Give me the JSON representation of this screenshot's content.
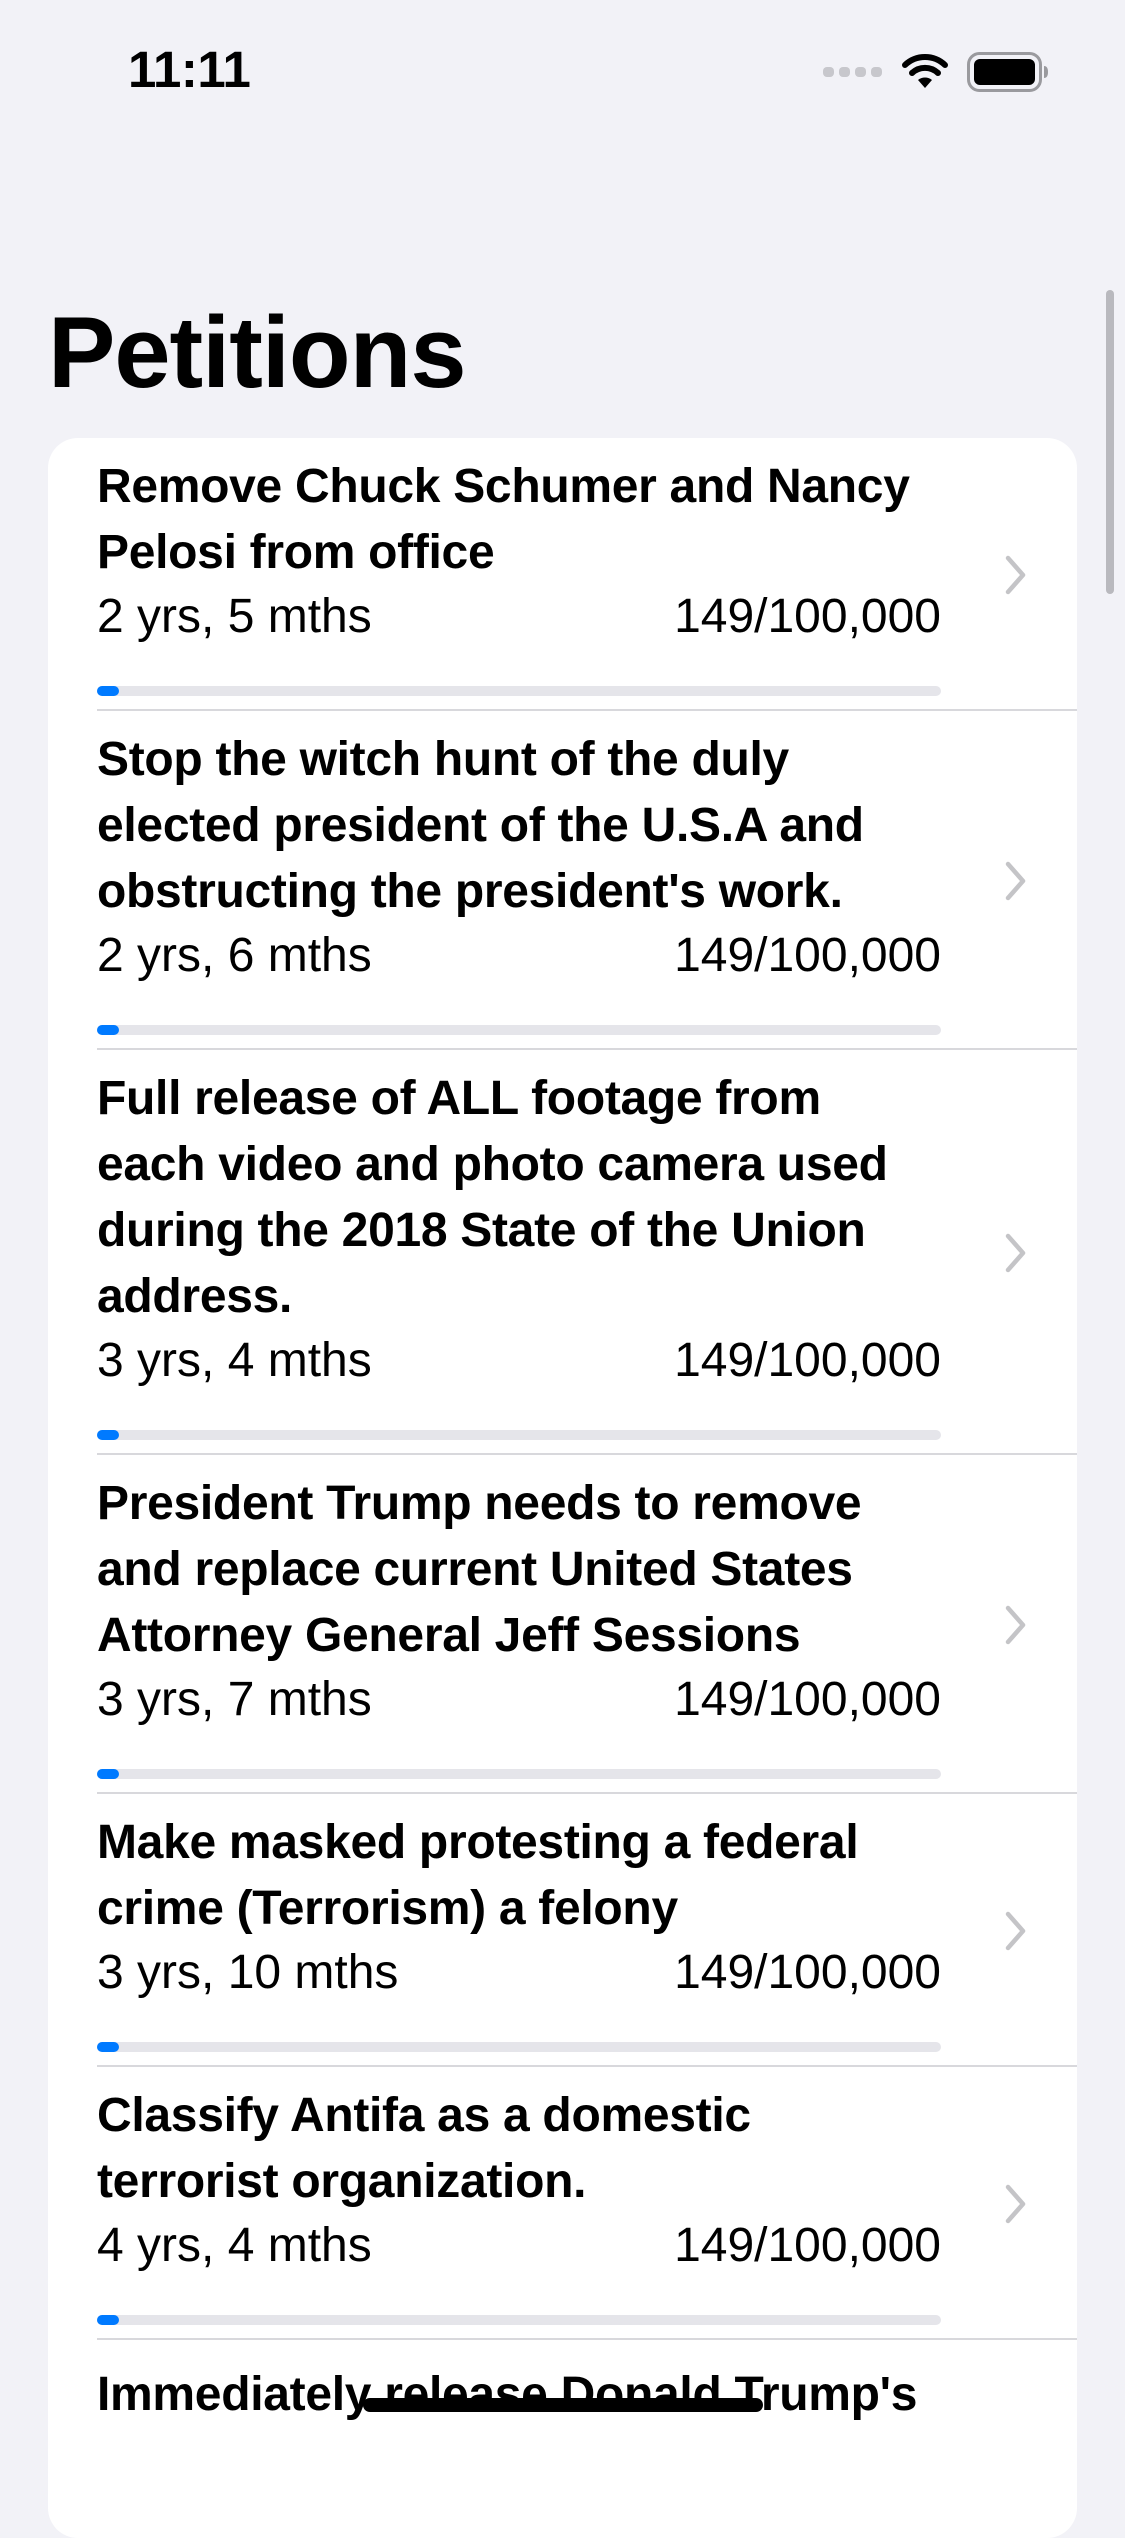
{
  "status_bar": {
    "time": "11:11",
    "icons": [
      "cellular-dots-icon",
      "wifi-icon",
      "battery-icon"
    ]
  },
  "navigation": {
    "large_title": "Petitions"
  },
  "colors": {
    "progress_fill": "#007aff",
    "progress_track": "#e5e5ea",
    "background": "#f2f2f7",
    "chevron": "#c4c4c7"
  },
  "petitions": [
    {
      "title": "Remove Chuck Schumer and Nancy Pelosi from office",
      "age": "2 yrs, 5 mths",
      "signatures": "149/100,000",
      "progress": 0.00149
    },
    {
      "title": "Stop the witch hunt of the duly elected president of the U.S.A  and obstructing the president's work.",
      "age": "2 yrs, 6 mths",
      "signatures": "149/100,000",
      "progress": 0.00149
    },
    {
      "title": "Full release of ALL footage from each video and photo camera used during the 2018 State of the Union address.",
      "age": "3 yrs, 4 mths",
      "signatures": "149/100,000",
      "progress": 0.00149
    },
    {
      "title": "President Trump needs to remove and replace current United States Attorney General Jeff Sessions",
      "age": "3 yrs, 7 mths",
      "signatures": "149/100,000",
      "progress": 0.00149
    },
    {
      "title": "Make masked protesting a federal crime (Terrorism) a felony",
      "age": "3 yrs, 10 mths",
      "signatures": "149/100,000",
      "progress": 0.00149
    },
    {
      "title": "Classify Antifa as a domestic terrorist organization.",
      "age": "4 yrs, 4 mths",
      "signatures": "149/100,000",
      "progress": 0.00149
    },
    {
      "title": "Immediately release Donald Trump's",
      "age": "",
      "signatures": "",
      "progress": null
    }
  ]
}
